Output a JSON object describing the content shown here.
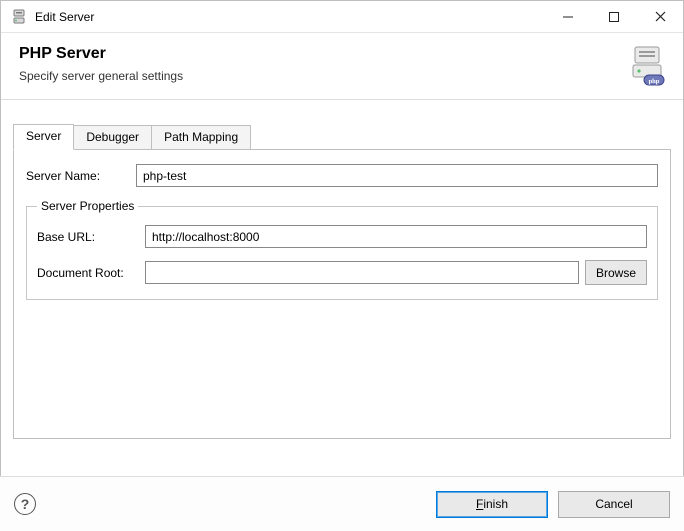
{
  "window": {
    "title": "Edit Server"
  },
  "banner": {
    "heading": "PHP Server",
    "subheading": "Specify server general settings"
  },
  "tabs": {
    "server": "Server",
    "debugger": "Debugger",
    "path_mapping": "Path Mapping",
    "active": "server"
  },
  "form": {
    "server_name_label": "Server Name:",
    "server_name_value": "php-test",
    "properties_legend": "Server Properties",
    "base_url_label": "Base URL:",
    "base_url_value": "http://localhost:8000",
    "document_root_label": "Document Root:",
    "document_root_value": "",
    "browse_label": "Browse"
  },
  "footer": {
    "finish_prefix": "F",
    "finish_rest": "inish",
    "cancel": "Cancel"
  }
}
